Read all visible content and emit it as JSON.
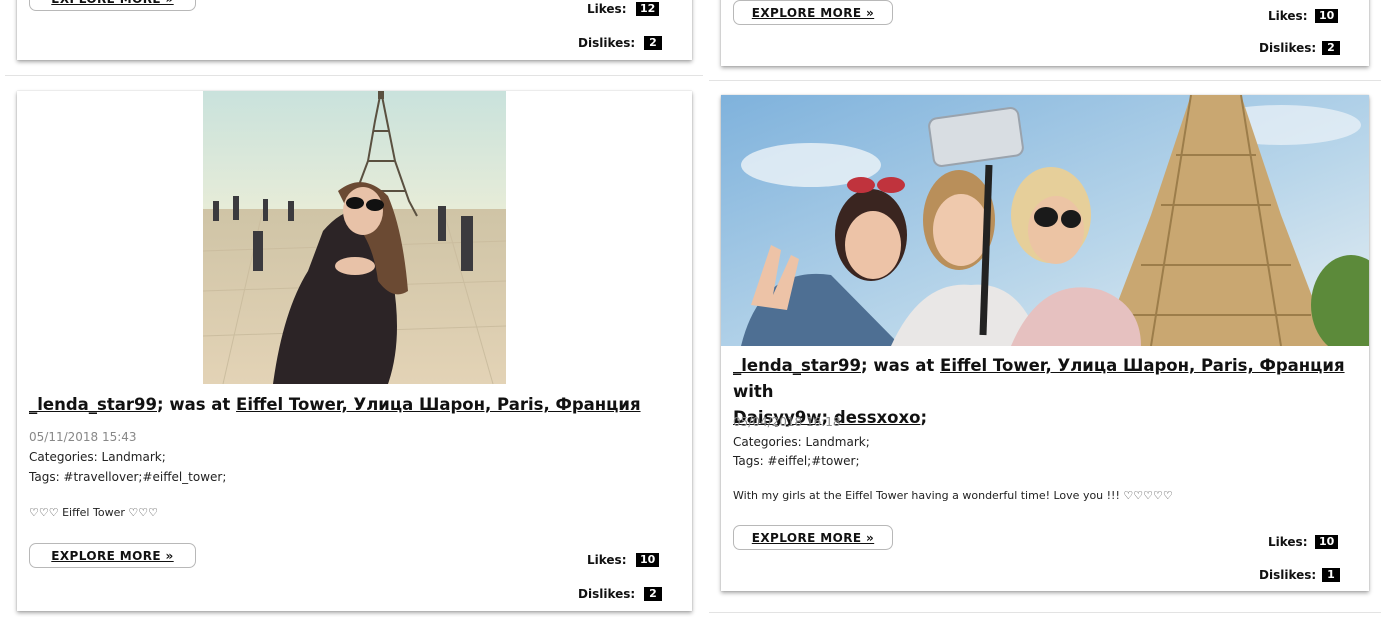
{
  "top_left": {
    "explore": "EXPLORE MORE »",
    "likes_label": "Likes:",
    "likes": "12",
    "dislikes_label": "Dislikes:",
    "dislikes": "2"
  },
  "top_right": {
    "explore": "EXPLORE MORE »",
    "likes_label": "Likes:",
    "likes": "10",
    "dislikes_label": "Dislikes:",
    "dislikes": "2"
  },
  "post_left": {
    "photo_icon": "eiffel-tower-girl-photo",
    "user": "_lenda_star99",
    "was_at": "; was at ",
    "place": "Eiffel Tower, Улица Шарон, Paris, Франция",
    "date": "05/11/2018 15:43",
    "categories": "Categories: Landmark;",
    "tags": "Tags: #travellover;#eiffel_tower;",
    "caption": "♡♡♡ Eiffel Tower ♡♡♡",
    "explore": "EXPLORE MORE »",
    "likes_label": "Likes:",
    "likes": "10",
    "dislikes_label": "Dislikes:",
    "dislikes": "2"
  },
  "post_right": {
    "photo_icon": "selfie-girls-eiffel-photo",
    "user": "_lenda_star99",
    "was_at": "; was at ",
    "place": "Eiffel Tower, Улица Шарон, Paris, Франция",
    "with": " with",
    "friend1": "Daisyy9w",
    "sep1": "; ",
    "friend2": "dessxoxo",
    "sep2": ";",
    "date": "05/04/2018 16:18",
    "categories": "Categories: Landmark;",
    "tags": "Tags: #eiffel;#tower;",
    "caption": "With my girls at the Eiffel Tower having a wonderful time! Love you !!! ♡♡♡♡♡",
    "explore": "EXPLORE MORE »",
    "likes_label": "Likes:",
    "likes": "10",
    "dislikes_label": "Dislikes:",
    "dislikes": "1"
  }
}
